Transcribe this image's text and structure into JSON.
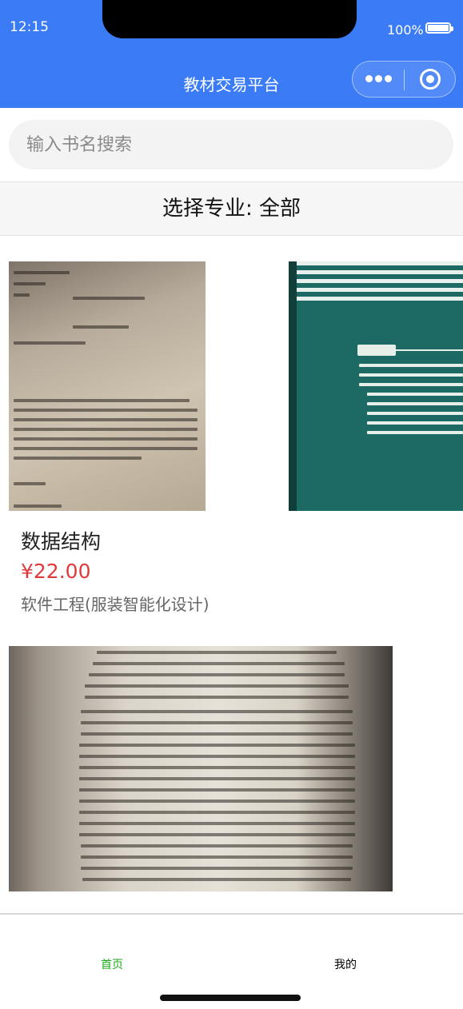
{
  "status_bar": {
    "time": "12:15",
    "battery": "100%"
  },
  "nav": {
    "title": "教材交易平台"
  },
  "search": {
    "placeholder": "输入书名搜索"
  },
  "filter": {
    "label": "选择专业: 全部"
  },
  "books": [
    {
      "title": "数据结构",
      "price": "¥22.00",
      "major": "软件工程(服装智能化设计)"
    }
  ],
  "tabbar": {
    "home": "首页",
    "mine": "我的"
  }
}
